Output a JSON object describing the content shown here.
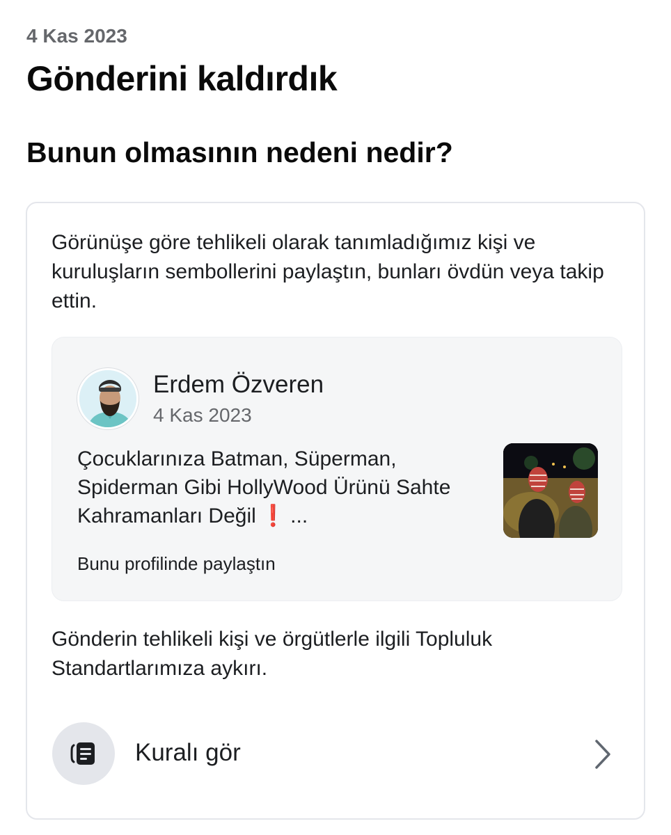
{
  "header": {
    "date": "4 Kas 2023",
    "title": "Gönderini kaldırdık"
  },
  "section": {
    "heading": "Bunun olmasının nedeni nedir?"
  },
  "card": {
    "reason": "Görünüşe göre tehlikeli olarak tanımladığımız kişi ve kuruluşların sembollerini paylaştın, bunları övdün veya takip ettin.",
    "post": {
      "author": "Erdem Özveren",
      "date": "4 Kas 2023",
      "text_line1": "Çocuklarınıza Batman, Süperman,",
      "text_line2": "Spiderman Gibi HollyWood Ürünü Sahte",
      "text_line3": "Kahramanları Değil",
      "emoji": "❗",
      "ellipsis": "...",
      "shared_note": "Bunu profilinde paylaştın"
    },
    "violation": "Gönderin tehlikeli kişi ve örgütlerle ilgili Topluluk Standartlarımıza aykırı.",
    "rule_link": {
      "label": "Kuralı gör",
      "icon": "document-stack-icon"
    }
  },
  "colors": {
    "secondary_text": "#65676b",
    "card_border": "#e4e6eb",
    "preview_bg": "#f5f6f7",
    "icon_circle": "#e4e6eb"
  }
}
